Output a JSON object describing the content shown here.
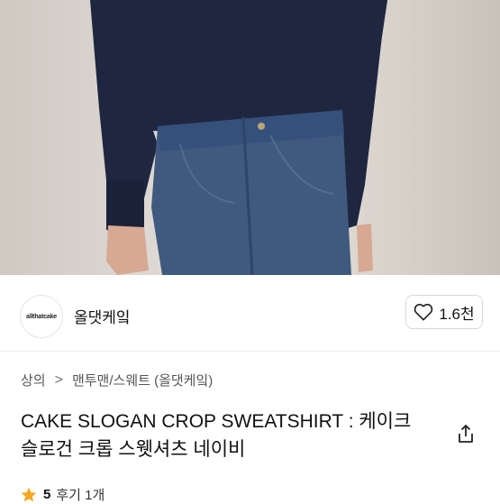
{
  "store": {
    "logo_text": "allthatcake",
    "name": "올댓케잌"
  },
  "like": {
    "icon": "heart-outline-icon",
    "count": "1.6천"
  },
  "breadcrumb": {
    "items": [
      "상의",
      "맨투맨/스웨트 (올댓케잌)"
    ],
    "separator": ">"
  },
  "product": {
    "title": "CAKE SLOGAN CROP SWEATSHIRT : 케이크 슬로건 크롭 스웻셔츠 네이비"
  },
  "rating": {
    "score": "5",
    "reviews": "후기 1개",
    "star_color": "#f5a623"
  },
  "colors": {
    "sweatshirt": "#1f2640",
    "denim": "#3f5a7e"
  }
}
